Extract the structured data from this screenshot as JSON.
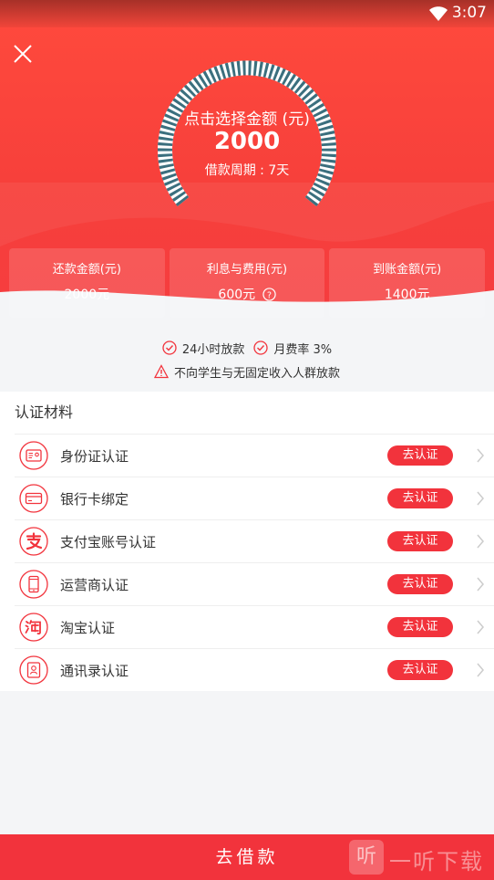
{
  "status": {
    "time": "3:07"
  },
  "gauge": {
    "label": "点击选择金额 (元)",
    "amount": "2000",
    "period": "借款周期 : 7天"
  },
  "cards": [
    {
      "title": "还款金额(元)",
      "value": "2000元"
    },
    {
      "title": "利息与费用(元)",
      "value": "600元"
    },
    {
      "title": "到账金额(元)",
      "value": "1400元"
    }
  ],
  "notes": {
    "fast": "24小时放款",
    "rate": "月费率 3%",
    "warning": "不向学生与无固定收入人群放款"
  },
  "auth": {
    "title": "认证材料",
    "button_label": "去认证",
    "items": [
      {
        "label": "身份证认证",
        "icon": "id-card-icon"
      },
      {
        "label": "银行卡绑定",
        "icon": "bank-card-icon"
      },
      {
        "label": "支付宝账号认证",
        "icon": "alipay-icon"
      },
      {
        "label": "运营商认证",
        "icon": "phone-icon"
      },
      {
        "label": "淘宝认证",
        "icon": "taobao-icon"
      },
      {
        "label": "通讯录认证",
        "icon": "contacts-icon"
      }
    ]
  },
  "submit": {
    "label": "去借款"
  },
  "watermark": {
    "glyph": "听",
    "text": "一听下载"
  },
  "colors": {
    "primary": "#f2333c",
    "hero": "#f7403b",
    "gauge_ticks": "#3b6f7e"
  }
}
